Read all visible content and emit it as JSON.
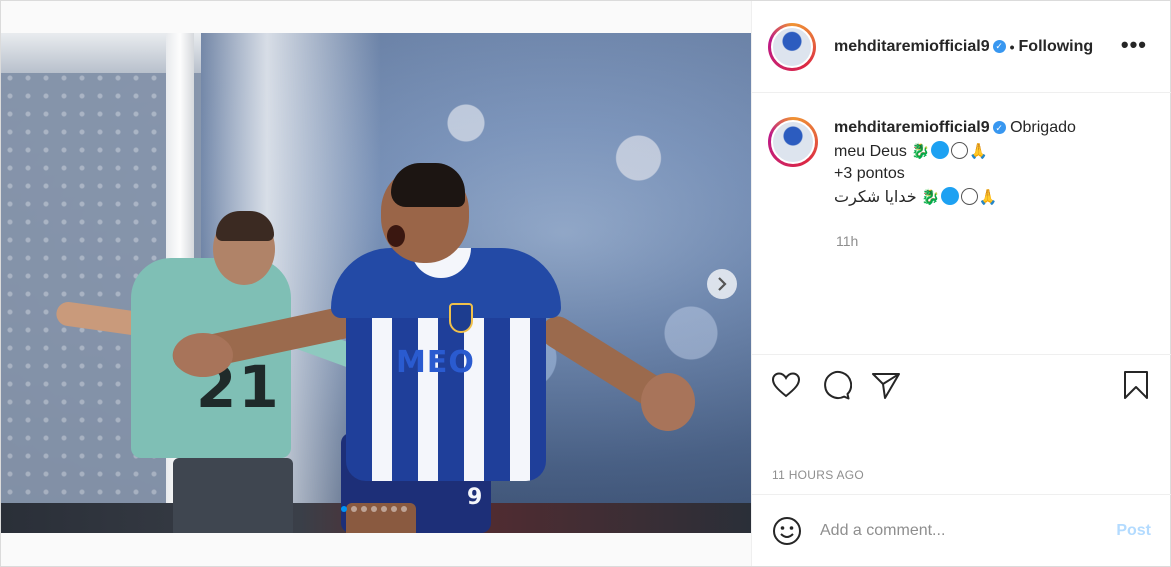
{
  "post": {
    "username": "mehditaremiofficial9",
    "follow_label": "Following",
    "separator": "•",
    "more_label": "•••",
    "caption": {
      "line1": "Obrigado",
      "line2": "meu Deus",
      "line3": "+3 pontos",
      "line4_text": "خدایا شکرت"
    },
    "time_ago": "11h",
    "posted_label": "11 HOURS AGO",
    "comment_placeholder": "Add a comment...",
    "post_button": "Post",
    "next_icon": "chevron-right-icon",
    "carousel": {
      "count": 7,
      "active_index": 0
    },
    "colors": {
      "accent": "#0095f6",
      "verified": "#3897f0",
      "post_button_disabled": "#b3dbff",
      "secondary_text": "#8e8e8e"
    },
    "photo": {
      "goalkeeper_number": "21",
      "sponsor": "MEO",
      "shorts_number": "9"
    }
  }
}
